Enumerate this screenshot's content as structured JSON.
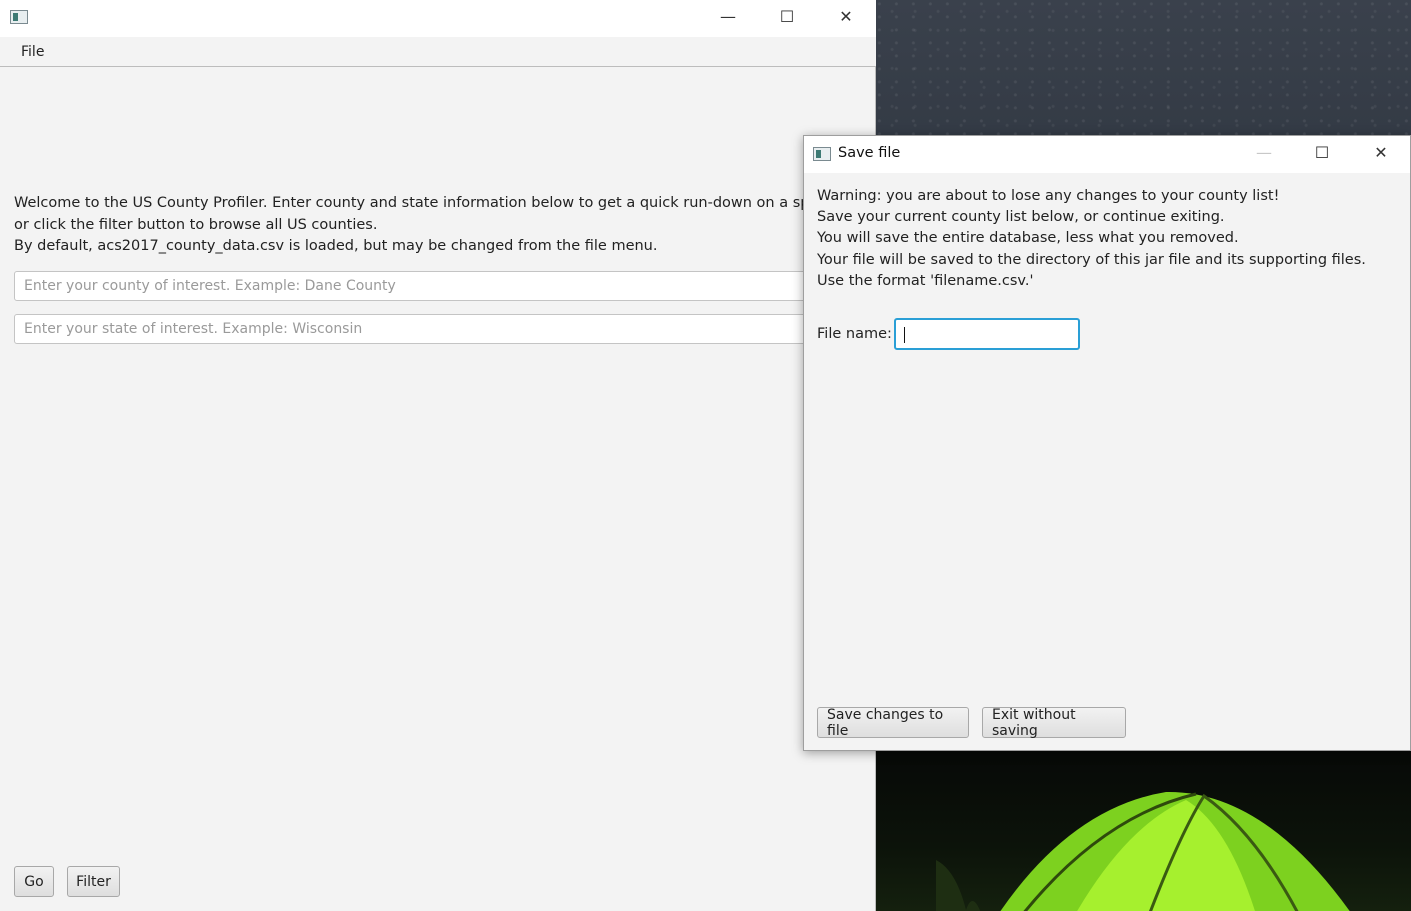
{
  "main_window": {
    "title": "",
    "menu": {
      "file_label": "File"
    },
    "welcome_lines": [
      "Welcome to the US County Profiler. Enter county and state information below to get a quick run-down on a specific county,",
      "or click the filter button to browse all US counties.",
      "By default, acs2017_county_data.csv is loaded, but may be changed from the file menu."
    ],
    "county_input": {
      "placeholder": "Enter your county of interest. Example: Dane County",
      "value": ""
    },
    "state_input": {
      "placeholder": "Enter your state of interest. Example: Wisconsin",
      "value": ""
    },
    "buttons": {
      "go": "Go",
      "filter": "Filter"
    }
  },
  "dialog": {
    "title": "Save file",
    "warning_lines": [
      "Warning: you are about to lose any changes to your county list!",
      "Save your current county list below, or continue exiting.",
      "You will save the entire database, less what you removed.",
      "Your file will be saved to the directory of this jar file and its supporting files.",
      "Use the format 'filename.csv.'"
    ],
    "file_name_label": "File name:",
    "file_name_value": "",
    "buttons": {
      "save": "Save changes to file",
      "exit": "Exit without saving"
    }
  },
  "window_controls": {
    "minimize": "—",
    "maximize": "☐",
    "close": "✕"
  }
}
